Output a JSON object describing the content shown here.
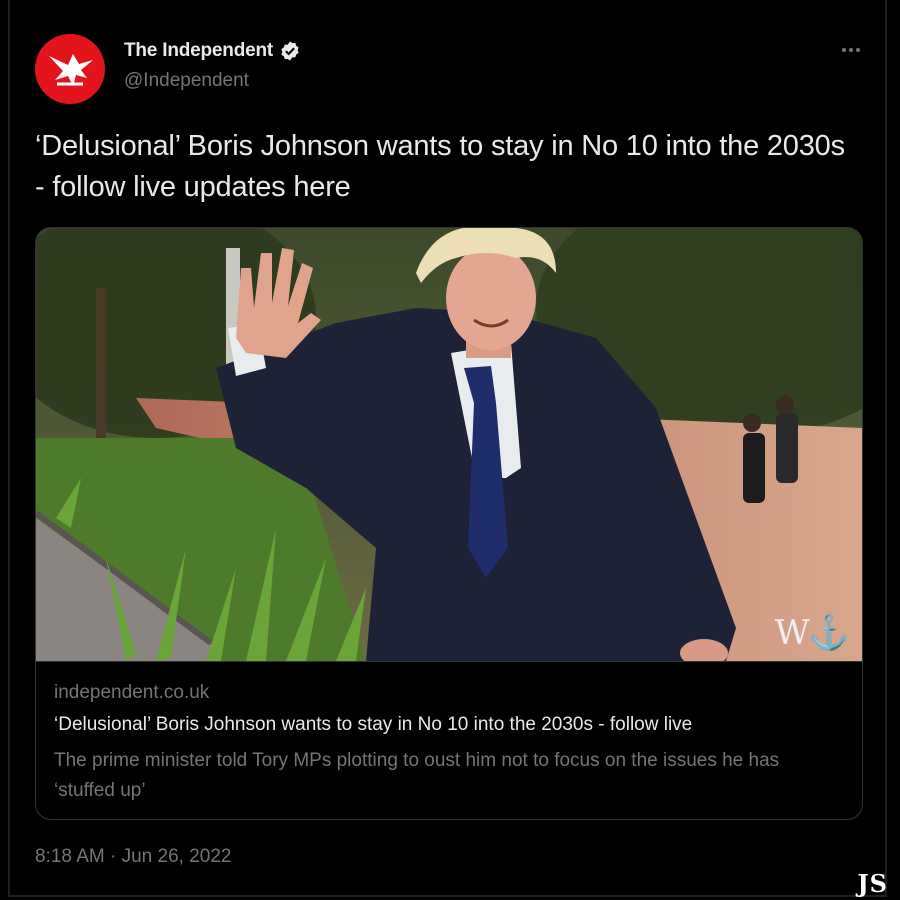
{
  "account": {
    "display_name": "The Independent",
    "handle": "@Independent",
    "verified": true,
    "avatar_color": "#e3141b"
  },
  "tweet": {
    "text": "‘Delusional’ Boris Johnson wants to stay in No 10 into the 2030s - follow live updates here",
    "timestamp": "8:18 AM · Jun 26, 2022"
  },
  "link_card": {
    "domain": "independent.co.uk",
    "title": "‘Delusional’ Boris Johnson wants to stay in No 10 into the 2030s - follow live",
    "description": "The prime minister told Tory MPs plotting to oust him not to focus on the issues he has ‘stuffed up’"
  },
  "icons": {
    "more": "more-options-icon",
    "verified": "verified-badge-icon",
    "avatar_logo": "eagle-logo"
  },
  "image_watermark": "W⚓",
  "corner_signature": "JS"
}
